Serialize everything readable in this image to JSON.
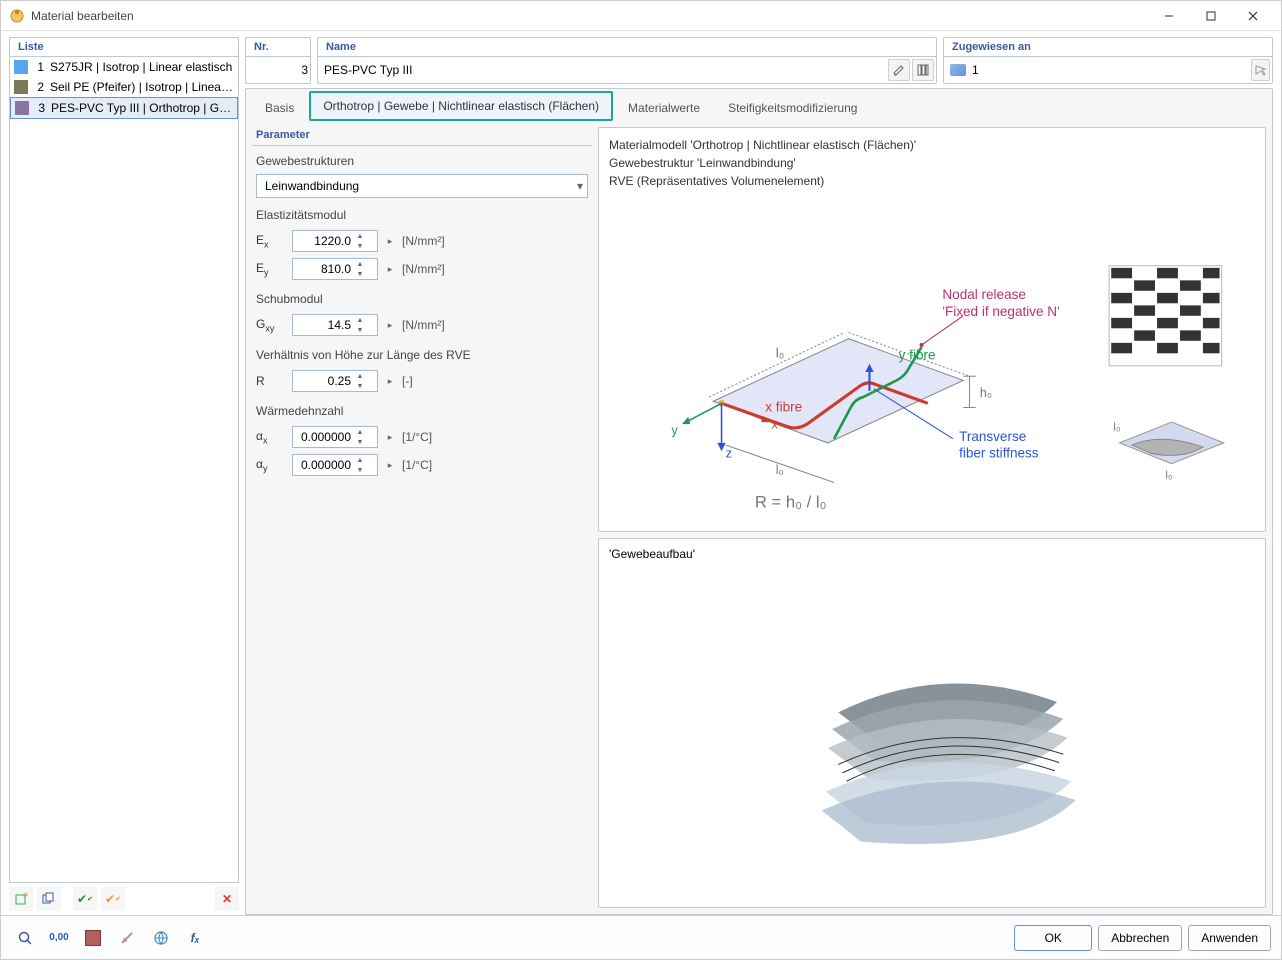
{
  "window": {
    "title": "Material bearbeiten"
  },
  "list": {
    "header": "Liste",
    "items": [
      {
        "num": "1",
        "label": "S275JR | Isotrop | Linear elastisch",
        "color": "#5aa3f0"
      },
      {
        "num": "2",
        "label": "Seil PE (Pfeifer) | Isotrop | Linear elastisch",
        "color": "#7a7a5a"
      },
      {
        "num": "3",
        "label": "PES-PVC Typ III | Orthotrop | Gewebe",
        "color": "#8a74a3"
      }
    ]
  },
  "fields": {
    "nr_label": "Nr.",
    "nr_value": "3",
    "name_label": "Name",
    "name_value": "PES-PVC Typ III",
    "assign_label": "Zugewiesen an",
    "assign_value": "1"
  },
  "tabs": {
    "basis": "Basis",
    "ortho": "Orthotrop | Gewebe | Nichtlinear elastisch (Flächen)",
    "materialwerte": "Materialwerte",
    "steifigkeit": "Steifigkeitsmodifizierung"
  },
  "params": {
    "header": "Parameter",
    "gewebe_label": "Gewebestrukturen",
    "gewebe_value": "Leinwandbindung",
    "emod_label": "Elastizitätsmodul",
    "Ex_sym": "Ex",
    "Ex_val": "1220.0",
    "Ex_unit": "[N/mm²]",
    "Ey_sym": "Ey",
    "Ey_val": "810.0",
    "Ey_unit": "[N/mm²]",
    "schub_label": "Schubmodul",
    "Gxy_sym": "Gxy",
    "Gxy_val": "14.5",
    "Gxy_unit": "[N/mm²]",
    "ratio_label": "Verhältnis von Höhe zur Länge des RVE",
    "R_sym": "R",
    "R_val": "0.25",
    "R_unit": "[-]",
    "warme_label": "Wärmedehnzahl",
    "ax_sym": "αx",
    "ax_val": "0.000000",
    "ax_unit": "[1/°C]",
    "ay_sym": "αy",
    "ay_val": "0.000000",
    "ay_unit": "[1/°C]"
  },
  "viz": {
    "line1": "Materialmodell 'Orthotrop | Nichtlinear elastisch (Flächen)'",
    "line2": "Gewebestruktur 'Leinwandbindung'",
    "line3": "RVE (Repräsentatives Volumenelement)",
    "nodal_release1": "Nodal release",
    "nodal_release2": "'Fixed if negative N'",
    "x_fibre": "x fibre",
    "y_fibre": "y fibre",
    "transverse1": "Transverse",
    "transverse2": "fiber stiffness",
    "R_formula": "R = h₀ / l₀",
    "gewebeaufbau": "'Gewebeaufbau'"
  },
  "footer": {
    "ok": "OK",
    "cancel": "Abbrechen",
    "apply": "Anwenden"
  }
}
